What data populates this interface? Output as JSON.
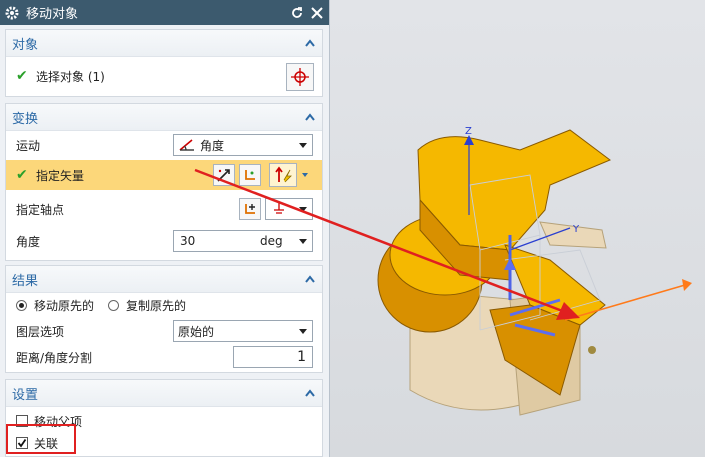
{
  "dialog": {
    "title": "移动对象",
    "object": {
      "title": "对象",
      "select_label": "选择对象 (1)"
    },
    "transform": {
      "title": "变换",
      "motion_label": "运动",
      "motion_value": "角度",
      "vector_label": "指定矢量",
      "pivot_label": "指定轴点",
      "angle_label": "角度",
      "angle_value": "30",
      "angle_unit": "deg"
    },
    "result": {
      "title": "结果",
      "move_original": "移动原先的",
      "copy_original": "复制原先的",
      "layer_label": "图层选项",
      "layer_value": "原始的",
      "distance_label": "距离/角度分割",
      "distance_value": "1"
    },
    "settings": {
      "title": "设置",
      "move_parent": "移动父项",
      "associative": "关联"
    }
  },
  "viewport": {
    "axis_z": "Z",
    "axis_y": "Y"
  },
  "colors": {
    "title_bg": "#3c5a6e",
    "section_title": "#2d6aa6",
    "highlight": "#fcd77a",
    "callout": "#e02020",
    "part_yellow": "#f5b800"
  }
}
